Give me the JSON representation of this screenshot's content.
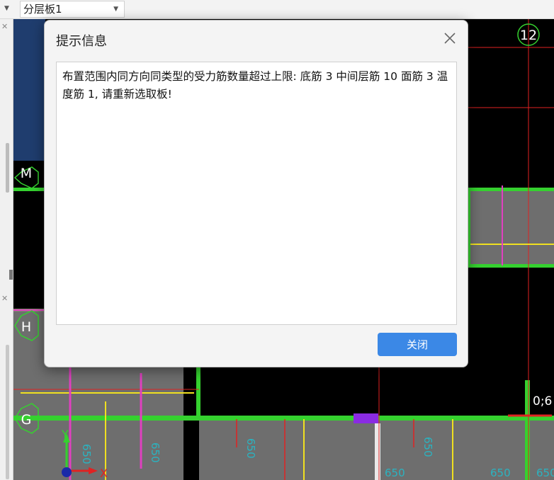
{
  "toolbar": {
    "layer_select": {
      "value": "分层板1"
    }
  },
  "dialog": {
    "title": "提示信息",
    "message": "布置范围内同方向同类型的受力筋数量超过上限: 底筋 3 中间层筋 10 面筋 3 温度筋 1, 请重新选取板!",
    "close_button_label": "关闭"
  },
  "drawing": {
    "grid_labels": [
      "12",
      "M",
      "H",
      "G"
    ],
    "dimension_labels": [
      "0;6",
      "650",
      "650",
      "650",
      "650",
      "650",
      "650",
      "650"
    ],
    "axis_labels": {
      "x": "X",
      "y": "Y"
    }
  },
  "colors": {
    "beam_green": "#35d12f",
    "cad_background": "#000000",
    "slab_gray": "#6e6e6e",
    "rebar_red": "#e02222",
    "rebar_yellow": "#f0e020",
    "rebar_magenta": "#e040c0",
    "dimension_cyan": "#2bb3c0",
    "dialog_button": "#3b88e6"
  }
}
